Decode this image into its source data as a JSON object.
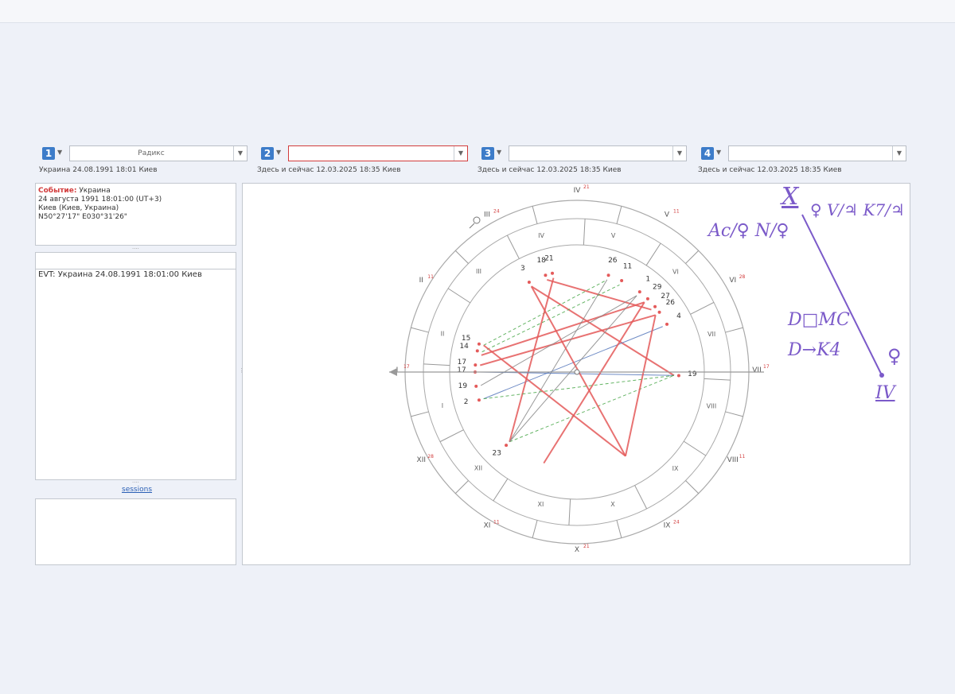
{
  "slots": [
    {
      "num": "1",
      "value": "Радикс",
      "info": "Украина 24.08.1991 18:01 Киев"
    },
    {
      "num": "2",
      "value": "",
      "info": "Здесь и сейчас 12.03.2025 18:35 Киев"
    },
    {
      "num": "3",
      "value": "",
      "info": "Здесь и сейчас 12.03.2025 18:35 Киев"
    },
    {
      "num": "4",
      "value": "",
      "info": "Здесь и сейчас 12.03.2025 18:35 Киев"
    }
  ],
  "event": {
    "label": "Событие:",
    "name": "Украина",
    "datetime": "24 августа 1991 18:01:00 (UT+3)",
    "place": "Киев (Киев, Украина)",
    "coords": "N50°27'17\" E030°31'26\""
  },
  "event_list": {
    "item": "EVT:  Украина 24.08.1991 18:01:00 Киев"
  },
  "links": {
    "sessions": "sessions"
  },
  "chart": {
    "house_labels_outer": [
      "I",
      "II",
      "III",
      "IV",
      "V",
      "VI",
      "VII",
      "VIII",
      "IX",
      "X",
      "XI",
      "XII"
    ],
    "house_labels_inner": [
      "I",
      "II",
      "III",
      "IV",
      "V",
      "VI",
      "VII",
      "VIII",
      "IX",
      "X",
      "XI",
      "XII"
    ],
    "cusp_degrees": [
      "17",
      "11",
      "24",
      "21",
      "11",
      "28",
      "17",
      "11",
      "24",
      "21",
      "11",
      "28"
    ],
    "planet_degrees": [
      "3",
      "18",
      "21",
      "26",
      "11",
      "1",
      "29",
      "27",
      "26",
      "4",
      "19",
      "14",
      "15",
      "17",
      "17",
      "19",
      "2",
      "23"
    ],
    "colors": {
      "red": "#e45a5a",
      "green": "#4aa84a",
      "blue": "#5577bb",
      "gray": "#888888"
    }
  },
  "handwriting": {
    "line1": "X",
    "line2": "♀ V/♃ K7/♃",
    "line3": "Ac/♀ N/♀",
    "line4": "D□MC",
    "line5": "D→K4",
    "line6": "♀",
    "line7": "IV"
  }
}
